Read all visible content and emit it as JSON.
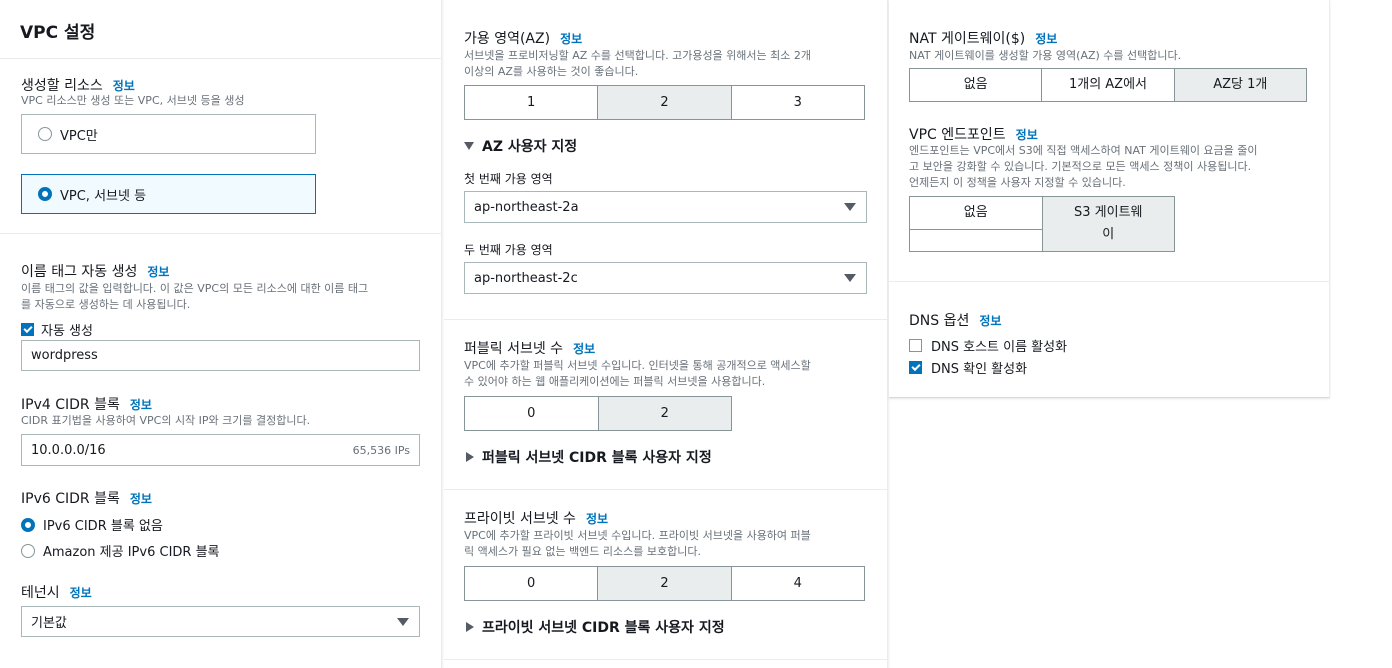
{
  "vpc_settings": {
    "title": "VPC 설정",
    "resources": {
      "label": "생성할 리소스",
      "info": "정보",
      "desc": "VPC 리소스만 생성 또는 VPC, 서브넷 등을 생성",
      "options": [
        {
          "label": "VPC만",
          "selected": false
        },
        {
          "label": "VPC, 서브넷 등",
          "selected": true
        }
      ]
    },
    "name_tag": {
      "label": "이름 태그 자동 생성",
      "info": "정보",
      "desc_line1": "이름 태그의 값을 입력합니다. 이 값은 VPC의 모든 리소스에 대한 이름 태그",
      "desc_line2": "를 자동으로 생성하는 데 사용됩니다.",
      "auto_label": "자동 생성",
      "auto_checked": true,
      "value": "wordpress"
    },
    "ipv4": {
      "label": "IPv4 CIDR 블록",
      "info": "정보",
      "desc": "CIDR 표기법을 사용하여 VPC의 시작 IP와 크기를 결정합니다.",
      "value": "10.0.0.0/16",
      "hint": "65,536 IPs"
    },
    "ipv6": {
      "label": "IPv6 CIDR 블록",
      "info": "정보",
      "options": [
        {
          "label": "IPv6 CIDR 블록 없음",
          "selected": true
        },
        {
          "label": "Amazon 제공 IPv6 CIDR 블록",
          "selected": false
        }
      ]
    },
    "tenancy": {
      "label": "테넌시",
      "info": "정보",
      "value": "기본값"
    }
  },
  "az": {
    "label": "가용 영역(AZ)",
    "info": "정보",
    "desc_line1": "서브넷을 프로비저닝할 AZ 수를 선택합니다. 고가용성을 위해서는 최소 2개",
    "desc_line2": "이상의 AZ를 사용하는 것이 좋습니다.",
    "options": [
      "1",
      "2",
      "3"
    ],
    "selected": "2",
    "customize_label": "AZ 사용자 지정",
    "first_label": "첫 번째 가용 영역",
    "first_value": "ap-northeast-2a",
    "second_label": "두 번째 가용 영역",
    "second_value": "ap-northeast-2c"
  },
  "public_subnets": {
    "label": "퍼블릭 서브넷 수",
    "info": "정보",
    "desc_line1": "VPC에 추가할 퍼블릭 서브넷 수입니다. 인터넷을 통해 공개적으로 액세스할",
    "desc_line2": "수 있어야 하는 웹 애플리케이션에는 퍼블릭 서브넷을 사용합니다.",
    "options": [
      "0",
      "2"
    ],
    "selected": "2",
    "customize_label": "퍼블릭 서브넷 CIDR 블록 사용자 지정"
  },
  "private_subnets": {
    "label": "프라이빗 서브넷 수",
    "info": "정보",
    "desc_line1": "VPC에 추가할 프라이빗 서브넷 수입니다. 프라이빗 서브넷을 사용하여 퍼블",
    "desc_line2": "릭 액세스가 필요 없는 백엔드 리소스를 보호합니다.",
    "options": [
      "0",
      "2",
      "4"
    ],
    "selected": "2",
    "customize_label": "프라이빗 서브넷 CIDR 블록 사용자 지정"
  },
  "nat": {
    "label": "NAT 게이트웨이($)",
    "info": "정보",
    "desc": "NAT 게이트웨이를 생성할 가용 영역(AZ) 수를 선택합니다.",
    "options": [
      "없음",
      "1개의 AZ에서",
      "AZ당 1개"
    ],
    "selected": "AZ당 1개"
  },
  "endpoint": {
    "label": "VPC 엔드포인트",
    "info": "정보",
    "desc_line1": "엔드포인트는 VPC에서 S3에 직접 액세스하여 NAT 게이트웨이 요금을 줄이",
    "desc_line2": "고 보안을 강화할 수 있습니다. 기본적으로 모든 액세스 정책이 사용됩니다.",
    "desc_line3": "언제든지 이 정책을 사용자 지정할 수 있습니다.",
    "options": [
      "없음",
      "S3 게이트웨",
      "이"
    ],
    "selected": "S3 게이트웨이"
  },
  "dns": {
    "label": "DNS 옵션",
    "info": "정보",
    "hostnames_label": "DNS 호스트 이름 활성화",
    "hostnames_checked": false,
    "resolution_label": "DNS 확인 활성화",
    "resolution_checked": true
  }
}
